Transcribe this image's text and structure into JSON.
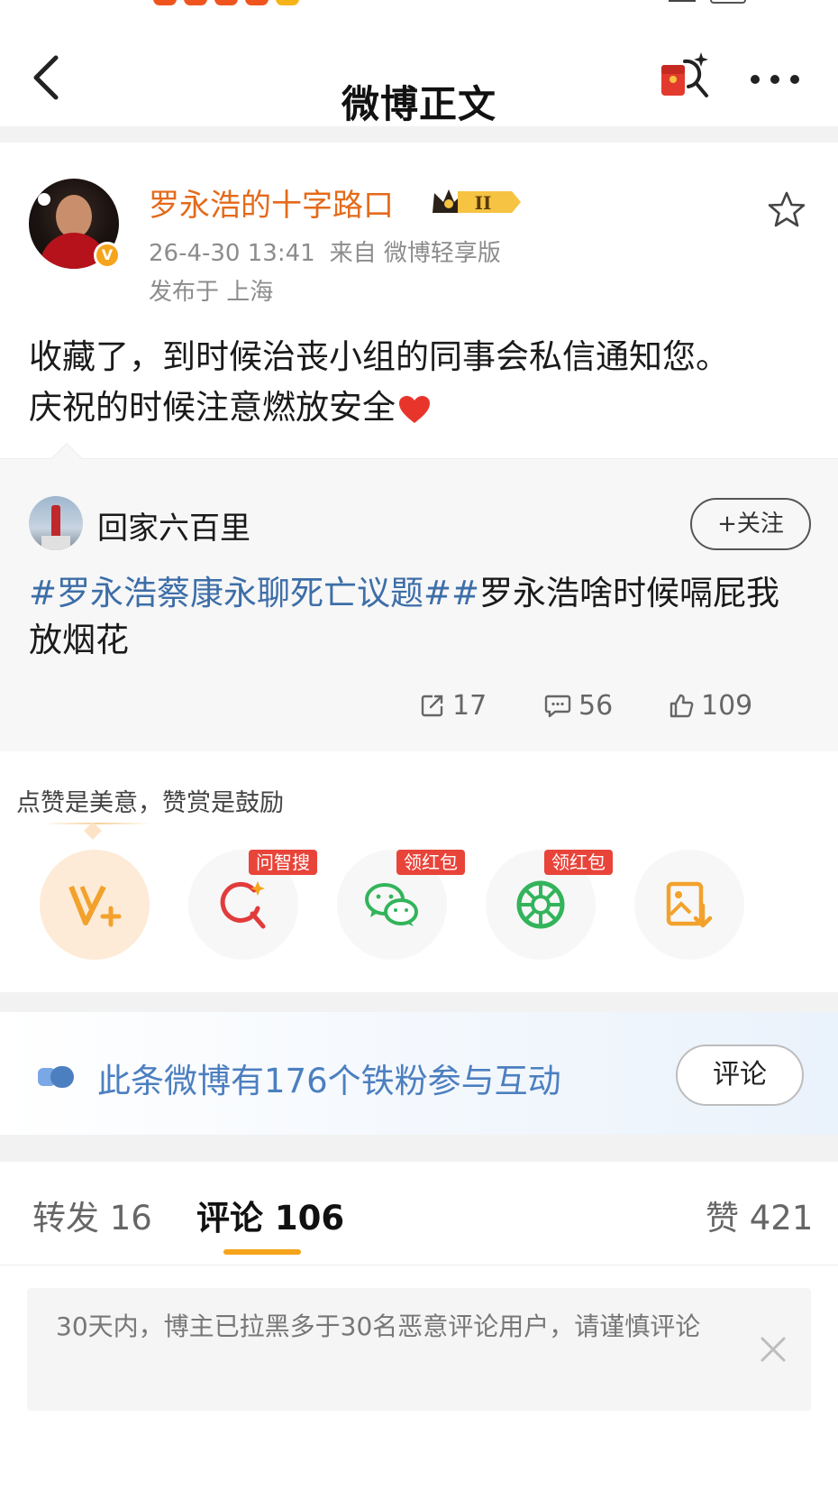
{
  "nav": {
    "title": "微博正文"
  },
  "post": {
    "author": "罗永浩的十字路口",
    "member_level": "II",
    "timestamp": "26-4-30 13:41",
    "source": "来自 微博轻享版",
    "location": "发布于 上海",
    "avatar_text": [
      "罗永浩",
      "的十字路口"
    ],
    "text_line1": "收藏了，到时候治丧小组的同事会私信通知您。",
    "text_line2": "庆祝的时候注意燃放安全"
  },
  "quoted": {
    "author": "回家六百里",
    "follow_label": "+关注",
    "tag1": "#罗永浩蔡康永聊死亡议题#",
    "tag2_and_text": "罗永浩啥时候嗝屁我放烟花",
    "reposts": "17",
    "comments": "56",
    "likes": "109"
  },
  "reward": {
    "hint": "点赞是美意，赞赏是鼓励",
    "tags": [
      "问智搜",
      "领红包",
      "领红包"
    ]
  },
  "fans": {
    "text": "此条微博有176个铁粉参与互动",
    "button": "评论"
  },
  "tabs": {
    "repost": "转发 16",
    "comment": "评论 106",
    "like": "赞 421"
  },
  "notice": {
    "text": "30天内，博主已拉黑多于30名恶意评论用户，请谨慎评论"
  },
  "colors": {
    "accent": "#f6a41c",
    "author_name": "#e46a1a",
    "topic_link": "#3d6ea8",
    "fans_text": "#4c7fc0",
    "tag_red": "#e8443a"
  }
}
